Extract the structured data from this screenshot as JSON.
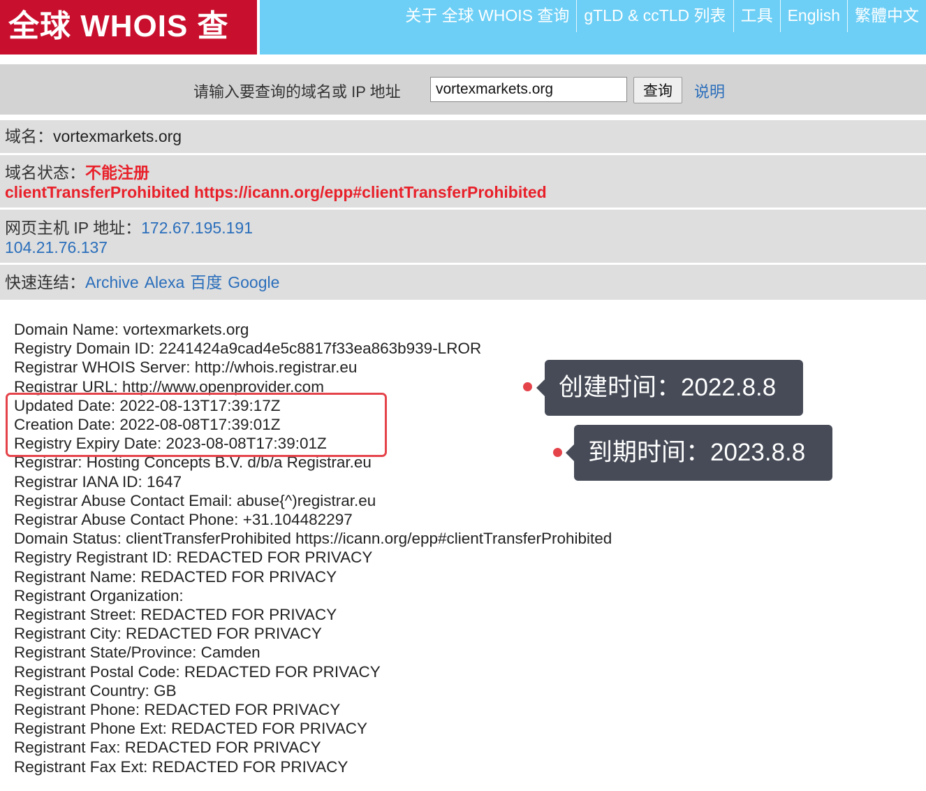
{
  "header": {
    "logo": "全球 WHOIS 查询",
    "nav": [
      {
        "label": "关于 全球 WHOIS 查询"
      },
      {
        "label": "gTLD & ccTLD 列表"
      },
      {
        "label": "工具"
      },
      {
        "label": "English"
      },
      {
        "label": "繁體中文"
      }
    ]
  },
  "search": {
    "label": "请输入要查询的域名或 IP 地址",
    "value": "vortexmarkets.org",
    "button": "查询",
    "help": "说明"
  },
  "info": {
    "domain_label": "域名：",
    "domain_value": "vortexmarkets.org",
    "status_label": "域名状态：",
    "status_value": "不能注册",
    "status_detail": "clientTransferProhibited https://icann.org/epp#clientTransferProhibited",
    "ip_label": "网页主机 IP 地址：",
    "ip_1": "172.67.195.191",
    "ip_2": "104.21.76.137",
    "links_label": "快速连结：",
    "links": [
      "Archive",
      "Alexa",
      "百度",
      "Google"
    ]
  },
  "whois_lines": [
    "Domain Name: vortexmarkets.org",
    "Registry Domain ID: 2241424a9cad4e5c8817f33ea863b939-LROR",
    "Registrar WHOIS Server: http://whois.registrar.eu",
    "Registrar URL: http://www.openprovider.com",
    "Updated Date: 2022-08-13T17:39:17Z",
    "Creation Date: 2022-08-08T17:39:01Z",
    "Registry Expiry Date: 2023-08-08T17:39:01Z",
    "Registrar: Hosting Concepts B.V. d/b/a Registrar.eu",
    "Registrar IANA ID: 1647",
    "Registrar Abuse Contact Email: abuse{^)registrar.eu",
    "Registrar Abuse Contact Phone: +31.104482297",
    "Domain Status: clientTransferProhibited https://icann.org/epp#clientTransferProhibited",
    "Registry Registrant ID: REDACTED FOR PRIVACY",
    "Registrant Name: REDACTED FOR PRIVACY",
    "Registrant Organization:",
    "Registrant Street: REDACTED FOR PRIVACY",
    "Registrant City: REDACTED FOR PRIVACY",
    "Registrant State/Province: Camden",
    "Registrant Postal Code: REDACTED FOR PRIVACY",
    "Registrant Country: GB",
    "Registrant Phone: REDACTED FOR PRIVACY",
    "Registrant Phone Ext: REDACTED FOR PRIVACY",
    "Registrant Fax: REDACTED FOR PRIVACY",
    "Registrant Fax Ext: REDACTED FOR PRIVACY"
  ],
  "annotations": {
    "created": "创建时间：2022.8.8",
    "expiry": "到期时间：2023.8.8"
  },
  "colors": {
    "header_bg": "#6dcff6",
    "logo_bg": "#c8102e",
    "highlight": "#e5434a",
    "callout_bg": "#464b57",
    "link": "#2a6ebb"
  }
}
